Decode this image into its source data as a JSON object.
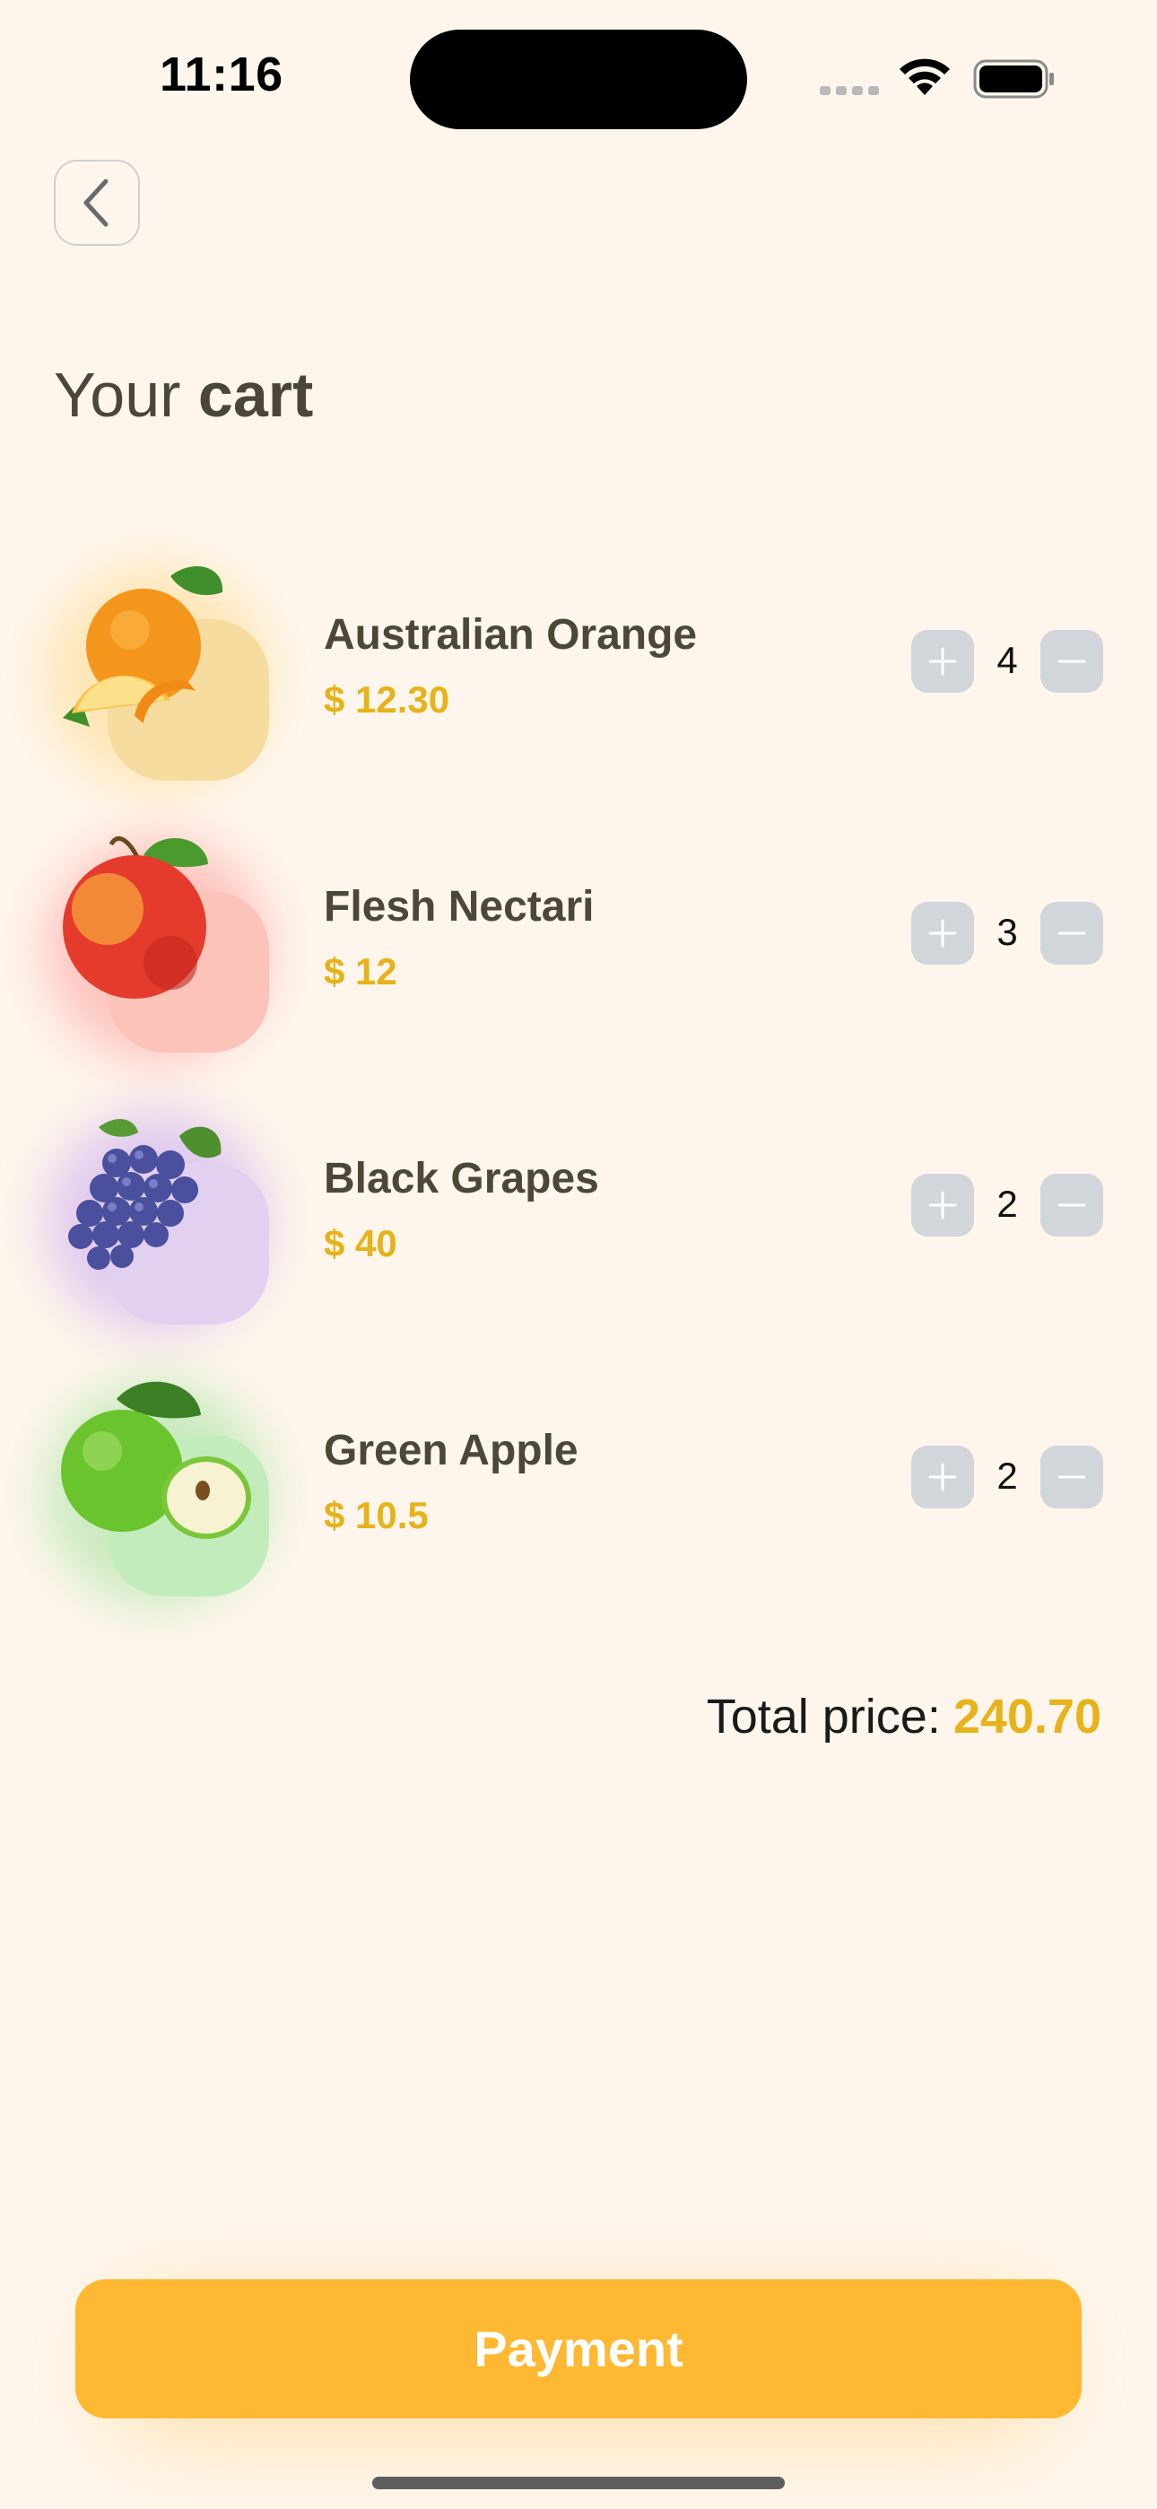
{
  "status_bar": {
    "time": "11:16"
  },
  "header": {
    "title_regular": "Your",
    "title_bold": "cart"
  },
  "cart": {
    "items": [
      {
        "name": "Australian Orange",
        "price": "$ 12.30",
        "quantity": "4",
        "accent": "#f7dca0",
        "glow": "#ffd98a",
        "icon": "orange-icon"
      },
      {
        "name": "Flesh Nectari",
        "price": "$ 12",
        "quantity": "3",
        "accent": "#fbc3b9",
        "glow": "#ff9a9a",
        "icon": "nectarine-icon"
      },
      {
        "name": "Black Grapes",
        "price": "$ 40",
        "quantity": "2",
        "accent": "#e2d0f0",
        "glow": "#c9a6f0",
        "icon": "grapes-icon"
      },
      {
        "name": "Green Apple",
        "price": "$ 10.5",
        "quantity": "2",
        "accent": "#c3ecbc",
        "glow": "#9fe09a",
        "icon": "apple-icon"
      }
    ]
  },
  "total": {
    "label": "Total price:",
    "amount": "240.70"
  },
  "actions": {
    "payment_label": "Payment"
  },
  "colors": {
    "background": "#fef6ec",
    "accent": "#e7b21a",
    "button": "#ffb831",
    "qty_button": "#d2d5da"
  }
}
